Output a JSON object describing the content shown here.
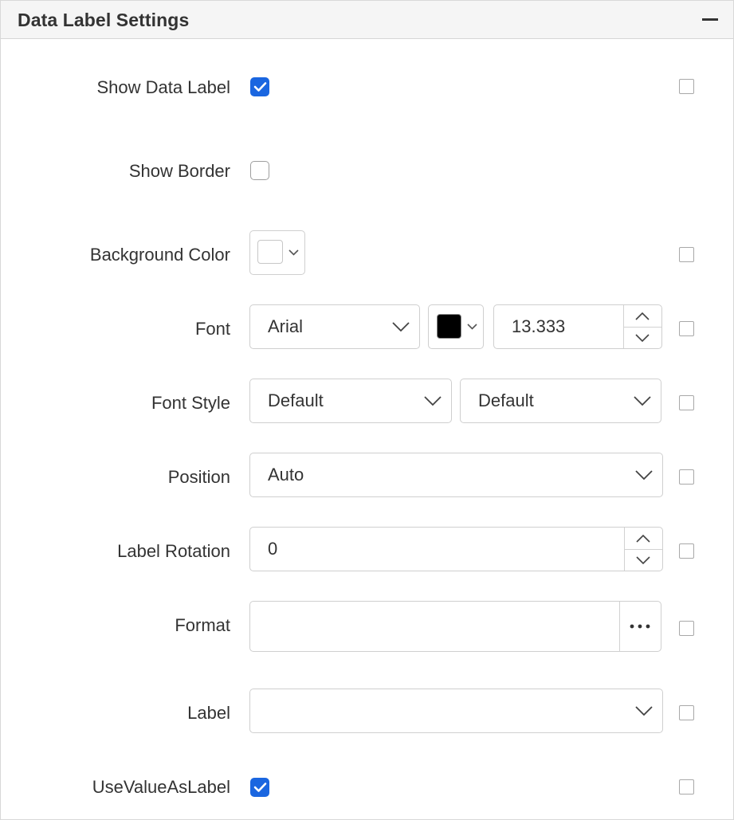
{
  "panel": {
    "title": "Data Label Settings"
  },
  "rows": {
    "show_data_label": {
      "label": "Show Data Label",
      "checked": true
    },
    "show_border": {
      "label": "Show Border",
      "checked": false
    },
    "background_color": {
      "label": "Background Color",
      "swatch_color": "#ffffff"
    },
    "font": {
      "label": "Font",
      "family": "Arial",
      "color": "#000000",
      "size": "13.333"
    },
    "font_style": {
      "label": "Font Style",
      "style": "Default",
      "weight": "Default"
    },
    "position": {
      "label": "Position",
      "value": "Auto"
    },
    "label_rotation": {
      "label": "Label Rotation",
      "value": "0"
    },
    "format": {
      "label": "Format",
      "value": ""
    },
    "label": {
      "label": "Label",
      "value": ""
    },
    "use_value_as_label": {
      "label": "UseValueAsLabel",
      "checked": true
    }
  },
  "colors": {
    "accent": "#1a66e0",
    "border": "#cfcfcf",
    "text": "#333333",
    "header_bg": "#f5f5f5"
  },
  "icons": [
    "minus-icon",
    "check-icon",
    "chevron-down-icon",
    "chevron-up-icon",
    "ellipsis-icon"
  ]
}
